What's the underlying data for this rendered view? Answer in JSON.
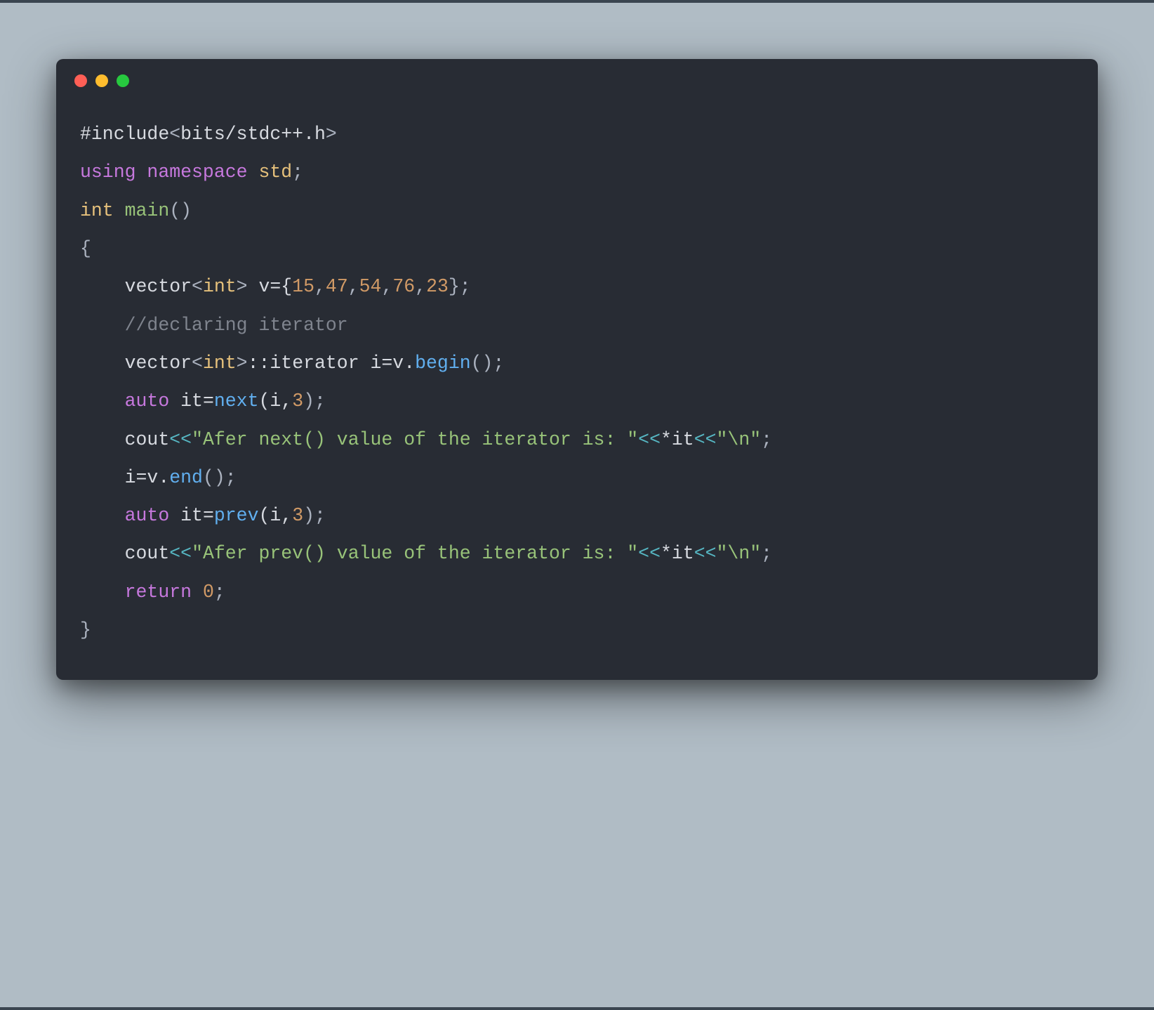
{
  "window": {
    "traffic_lights": [
      "red",
      "yellow",
      "green"
    ]
  },
  "code": {
    "l1_include": "#include",
    "l1_open": "<",
    "l1_path": "bits/stdc++.h",
    "l1_close": ">",
    "l2_using": "using",
    "l2_namespace": "namespace",
    "l2_std": "std",
    "l2_semi": ";",
    "l3_int": "int",
    "l3_main": "main",
    "l3_pp": "()",
    "l4_brace": "{",
    "l5_indent": "    ",
    "l5_vector": "vector",
    "l5_lt": "<",
    "l5_int": "int",
    "l5_gt": ">",
    "l5_vbe": " v={",
    "l5_n0": "15",
    "l5_c0": ",",
    "l5_n1": "47",
    "l5_c1": ",",
    "l5_n2": "54",
    "l5_c2": ",",
    "l5_n3": "76",
    "l5_c3": ",",
    "l5_n4": "23",
    "l5_end": "};",
    "l6_indent": "    ",
    "l6_comment": "//declaring iterator",
    "l7_indent": "    ",
    "l7_vector": "vector",
    "l7_lt": "<",
    "l7_int": "int",
    "l7_gt": ">",
    "l7_dcol": "::iterator i=v.",
    "l7_begin": "begin",
    "l7_tail": "();",
    "l8_indent": "    ",
    "l8_auto": "auto",
    "l8_it": " it=",
    "l8_next": "next",
    "l8_open": "(i,",
    "l8_num": "3",
    "l8_close": ");",
    "l9_indent": "    ",
    "l9_cout": "cout",
    "l9_op1": "<<",
    "l9_str": "\"Afer next() value of the iterator is: \"",
    "l9_op2": "<<",
    "l9_star": "*it",
    "l9_op3": "<<",
    "l9_nl": "\"\\n\"",
    "l9_semi": ";",
    "l10_indent": "    ",
    "l10_body": "i=v.",
    "l10_end": "end",
    "l10_tail": "();",
    "l11_indent": "    ",
    "l11_auto": "auto",
    "l11_it": " it=",
    "l11_prev": "prev",
    "l11_open": "(i,",
    "l11_num": "3",
    "l11_close": ");",
    "l12_indent": "    ",
    "l12_cout": "cout",
    "l12_op1": "<<",
    "l12_str": "\"Afer prev() value of the iterator is: \"",
    "l12_op2": "<<",
    "l12_star": "*it",
    "l12_op3": "<<",
    "l12_nl": "\"\\n\"",
    "l12_semi": ";",
    "l13_indent": "    ",
    "l13_return": "return",
    "l13_sp": " ",
    "l13_zero": "0",
    "l13_semi": ";",
    "l14_brace": "}"
  }
}
